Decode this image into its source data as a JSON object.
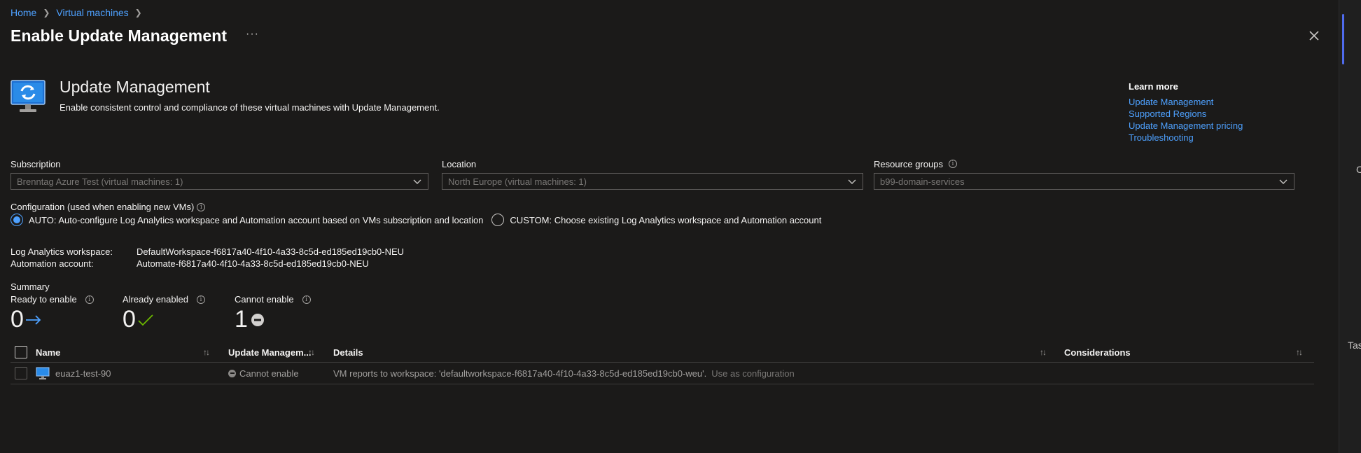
{
  "breadcrumb": {
    "home": "Home",
    "vms": "Virtual machines"
  },
  "title": "Enable Update Management",
  "more_label": "···",
  "hero": {
    "title": "Update Management",
    "description": "Enable consistent control and compliance of these virtual machines with Update Management."
  },
  "learn_more": {
    "heading": "Learn more",
    "links": [
      "Update Management",
      "Supported Regions",
      "Update Management pricing",
      "Troubleshooting"
    ]
  },
  "fields": {
    "subscription": {
      "label": "Subscription",
      "value": "Brenntag Azure Test (virtual machines: 1)"
    },
    "location": {
      "label": "Location",
      "value": "North Europe (virtual machines: 1)"
    },
    "resource_groups": {
      "label": "Resource groups",
      "value": "b99-domain-services"
    }
  },
  "configuration": {
    "label": "Configuration (used when enabling new VMs)",
    "auto_label": "AUTO: Auto-configure Log Analytics workspace and Automation account based on VMs subscription and location",
    "custom_label": "CUSTOM: Choose existing Log Analytics workspace and Automation account",
    "selected": "auto"
  },
  "workspace": {
    "law_label": "Log Analytics workspace:",
    "law_value": "DefaultWorkspace-f6817a40-4f10-4a33-8c5d-ed185ed19cb0-NEU",
    "aa_label": "Automation account:",
    "aa_value": "Automate-f6817a40-4f10-4a33-8c5d-ed185ed19cb0-NEU"
  },
  "summary": {
    "label": "Summary",
    "ready": {
      "label": "Ready to enable",
      "count": "0"
    },
    "already": {
      "label": "Already enabled",
      "count": "0"
    },
    "cannot": {
      "label": "Cannot enable",
      "count": "1"
    }
  },
  "table": {
    "headers": {
      "name": "Name",
      "update": "Update Managem...",
      "details": "Details",
      "considerations": "Considerations"
    },
    "rows": [
      {
        "name": "euaz1-test-90",
        "status": "Cannot enable",
        "details": "VM reports to workspace: 'defaultworkspace-f6817a40-4f10-4a33-8c5d-ed185ed19cb0-weu'.",
        "action": "Use as configuration",
        "considerations": ""
      }
    ]
  },
  "outside": {
    "char1": "C",
    "char2": "Tas"
  },
  "colors": {
    "link": "#4ea1ff",
    "background": "#1b1a19",
    "success": "#6bb700",
    "accent": "#4f6bed"
  }
}
